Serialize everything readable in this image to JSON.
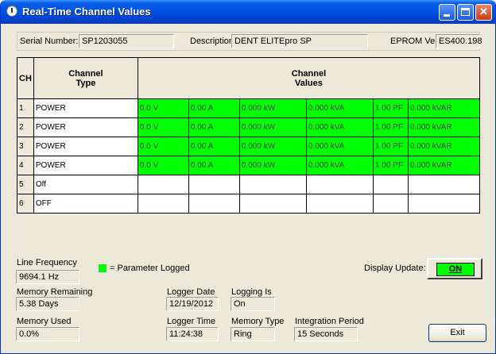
{
  "window": {
    "title": "Real-Time Channel Values"
  },
  "header": {
    "serial_label": "Serial Number:",
    "serial_value": "SP1203055",
    "description_label": "Description:",
    "description_value": "DENT ELITEpro SP",
    "eprom_label": "EPROM Ver:",
    "eprom_value": "ES400.198"
  },
  "grid": {
    "col_ch": "CH",
    "col_type_1": "Channel",
    "col_type_2": "Type",
    "col_values_1": "Channel",
    "col_values_2": "Values",
    "rows": [
      {
        "ch": "1",
        "type": "POWER",
        "v": "0.0 V",
        "a": "0.00 A",
        "kw": "0.000 kW",
        "kva": "0.000 kVA",
        "pf": "1.00 PF",
        "kvar": "0.000 kVAR",
        "logged": true
      },
      {
        "ch": "2",
        "type": "POWER",
        "v": "0.0 V",
        "a": "0.00 A",
        "kw": "0.000 kW",
        "kva": "0.000 kVA",
        "pf": "1.00 PF",
        "kvar": "0.000 kVAR",
        "logged": true
      },
      {
        "ch": "3",
        "type": "POWER",
        "v": "0.0 V",
        "a": "0.00 A",
        "kw": "0.000 kW",
        "kva": "0.000 kVA",
        "pf": "1.00 PF",
        "kvar": "0.000 kVAR",
        "logged": true
      },
      {
        "ch": "4",
        "type": "POWER",
        "v": "0.0 V",
        "a": "0.00 A",
        "kw": "0.000 kW",
        "kva": "0.000 kVA",
        "pf": "1.00 PF",
        "kvar": "0.000 kVAR",
        "logged": true
      },
      {
        "ch": "5",
        "type": "Off",
        "v": "",
        "a": "",
        "kw": "",
        "kva": "",
        "pf": "",
        "kvar": "",
        "logged": false
      },
      {
        "ch": "6",
        "type": "OFF",
        "v": "",
        "a": "",
        "kw": "",
        "kva": "",
        "pf": "",
        "kvar": "",
        "logged": false
      }
    ]
  },
  "legend": {
    "text": "= Parameter Logged",
    "color": "#00ff00"
  },
  "status": {
    "line_freq_label": "Line Frequency",
    "line_freq_value": "9694.1 Hz",
    "mem_remaining_label": "Memory Remaining",
    "mem_remaining_value": "5.38 Days",
    "mem_used_label": "Memory Used",
    "mem_used_value": "0.0%",
    "logger_date_label": "Logger Date",
    "logger_date_value": "12/19/2012",
    "logger_time_label": "Logger Time",
    "logger_time_value": "11:24:38",
    "logging_is_label": "Logging Is",
    "logging_is_value": "On",
    "memory_type_label": "Memory Type",
    "memory_type_value": "Ring",
    "integration_label": "Integration Period",
    "integration_value": "15 Seconds",
    "display_update_label": "Display Update:",
    "display_update_value": "ON"
  },
  "buttons": {
    "exit": "Exit"
  }
}
